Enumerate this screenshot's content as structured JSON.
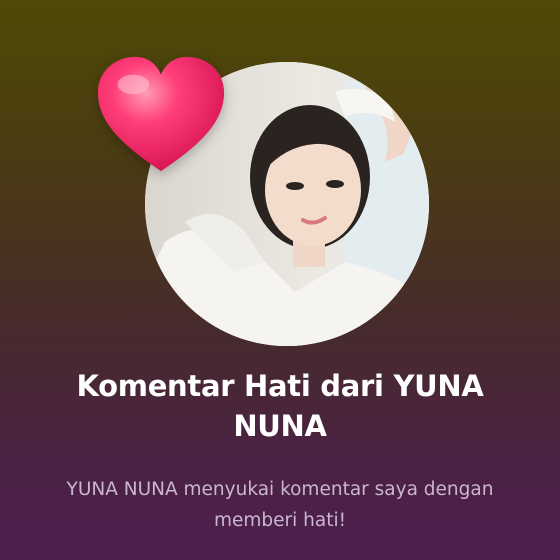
{
  "notification": {
    "title": "Komentar Hati dari YUNA NUNA",
    "message": "YUNA NUNA menyukai komentar saya dengan memberi hati!",
    "heart_icon": "heart-icon",
    "heart_color": "#ff2d6e"
  }
}
